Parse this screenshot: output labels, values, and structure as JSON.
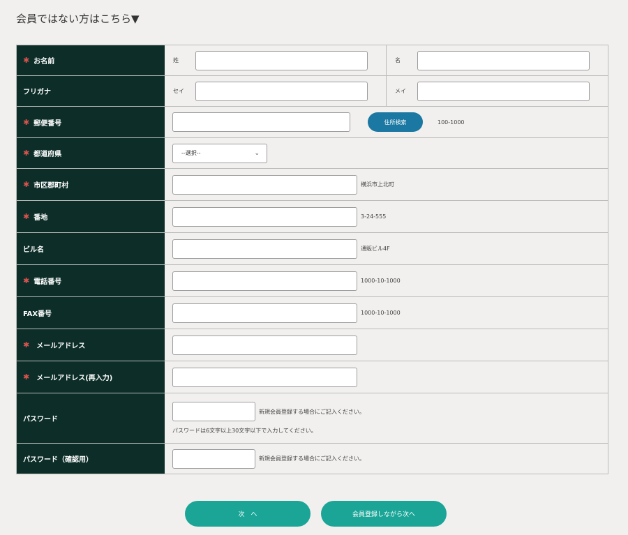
{
  "title": "会員ではない方はこちら▼",
  "required_mark": "✱",
  "labels": {
    "name": "お名前",
    "furigana": "フリガナ",
    "zip": "郵便番号",
    "pref": "都道府県",
    "city": "市区郡町村",
    "address": "番地",
    "building": "ビル名",
    "tel": "電話番号",
    "fax": "FAX番号",
    "email": "メールアドレス",
    "email_confirm": "メールアドレス(再入力)",
    "password": "パスワード",
    "password_confirm": "パスワード（確認用）"
  },
  "sub_labels": {
    "last_name": "姓",
    "first_name": "名",
    "last_kana": "セイ",
    "first_kana": "メイ"
  },
  "zip_search_button": "住所検索",
  "hints": {
    "zip": "100-1000",
    "city": "横浜市上北町",
    "address": "3-24-555",
    "building": "通販ビル4F",
    "tel": "1000-10-1000",
    "fax": "1000-10-1000",
    "password": "新規会員登録する場合にご記入ください。",
    "password_rule": "パスワードは6文字以上30文字以下で入力してください。",
    "password_confirm": "新規会員登録する場合にご記入ください。"
  },
  "pref_select": "--選択--",
  "buttons": {
    "next": "次　へ",
    "register_next": "会員登録しながら次へ"
  },
  "colors": {
    "label_bg": "#0d2e28",
    "accent": "#1aa597",
    "search_btn": "#1b78a2",
    "required": "#d9534f"
  }
}
